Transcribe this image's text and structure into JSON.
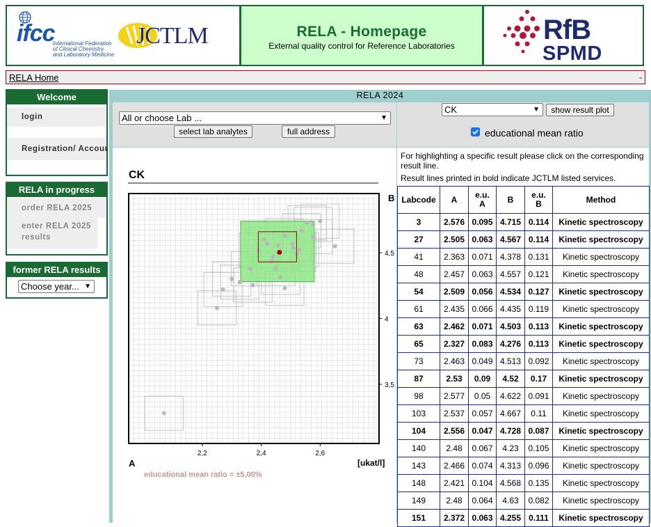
{
  "header": {
    "left_logo_1_text": "ifcc",
    "left_logo_1_sub": [
      "International Federation",
      "of Clinical Chemistry",
      "and Laboratory Medicine"
    ],
    "left_logo_2_text": "JCTLM",
    "title": "RELA - Homepage",
    "subtitle": "External quality control for Reference Laboratories",
    "right_logo_line1": "RfB",
    "right_logo_line2": "SPMD"
  },
  "navbar": {
    "home_link": "RELA Home",
    "right_text": "-"
  },
  "sidebar": {
    "welcome": {
      "title": "Welcome",
      "items": [
        "login",
        "Registration/ Account"
      ]
    },
    "progress": {
      "title": "RELA in progress",
      "items": [
        "order RELA 2025",
        "enter RELA 2025 results"
      ]
    },
    "former": {
      "title": "former RELA results",
      "select_value": "Choose year..."
    }
  },
  "main": {
    "title": "RELA 2024",
    "lab_select": "All or choose Lab ...",
    "select_analytes_button": "select lab analytes",
    "full_address_button": "full address",
    "analyte_select": "CK",
    "show_plot_button": "show result plot",
    "emr_checkbox_label": "educational mean ratio",
    "emr_checked": true,
    "info_line1": "For highlighting a specific result please click on the corresponding",
    "info_line2": "result line.",
    "info_line3": "Result lines printed in bold indicate JCTLM listed services."
  },
  "plot": {
    "title": "CK",
    "x_axis_label": "A",
    "y_axis_label": "B",
    "unit_label": "[ukat/l]",
    "emr_note": "educational mean ratio = ±5,00%",
    "x_ticks": [
      "2,2",
      "2,4",
      "2,6"
    ],
    "y_ticks": [
      "4,5",
      "4",
      "3,5"
    ]
  },
  "chart_data": {
    "type": "scatter",
    "x_axis": "A",
    "y_axis": "B",
    "xlim": [
      1.95,
      2.8
    ],
    "ylim": [
      3.05,
      4.95
    ],
    "grid": true,
    "points": [
      [
        2.576,
        4.715
      ],
      [
        2.505,
        4.567
      ],
      [
        2.363,
        4.378
      ],
      [
        2.457,
        4.557
      ],
      [
        2.509,
        4.534
      ],
      [
        2.435,
        4.435
      ],
      [
        2.462,
        4.503
      ],
      [
        2.327,
        4.276
      ],
      [
        2.463,
        4.513
      ],
      [
        2.53,
        4.52
      ],
      [
        2.577,
        4.622
      ],
      [
        2.537,
        4.667
      ],
      [
        2.556,
        4.728
      ],
      [
        2.48,
        4.23
      ],
      [
        2.466,
        4.313
      ],
      [
        2.421,
        4.568
      ],
      [
        2.48,
        4.63
      ],
      [
        2.372,
        4.255
      ],
      [
        2.6,
        4.74
      ],
      [
        2.65,
        4.55
      ],
      [
        2.3,
        4.3
      ],
      [
        2.27,
        4.22
      ],
      [
        2.25,
        4.08
      ],
      [
        2.44,
        4.47
      ],
      [
        2.41,
        4.6
      ],
      [
        2.39,
        4.52
      ],
      [
        2.45,
        4.38
      ],
      [
        2.52,
        4.49
      ],
      [
        2.07,
        3.28
      ]
    ],
    "highlight_point": [
      2.462,
      4.503
    ],
    "green_box": {
      "x": [
        2.33,
        2.58
      ],
      "y": [
        4.28,
        4.74
      ]
    },
    "red_box": {
      "x": [
        2.39,
        2.52
      ],
      "y": [
        4.43,
        4.66
      ]
    }
  },
  "table": {
    "headers": [
      "Labcode",
      "A",
      "e.u. A",
      "B",
      "e.u. B",
      "Method"
    ],
    "rows": [
      {
        "bold": true,
        "cells": [
          "3",
          "2.576",
          "0.095",
          "4.715",
          "0.114",
          "Kinetic spectroscopy"
        ]
      },
      {
        "bold": true,
        "cells": [
          "27",
          "2.505",
          "0.063",
          "4.567",
          "0.114",
          "Kinetic spectroscopy"
        ]
      },
      {
        "bold": false,
        "cells": [
          "41",
          "2.363",
          "0.071",
          "4.378",
          "0.131",
          "Kinetic spectroscopy"
        ]
      },
      {
        "bold": false,
        "cells": [
          "48",
          "2.457",
          "0.063",
          "4.557",
          "0.121",
          "Kinetic spectroscopy"
        ]
      },
      {
        "bold": true,
        "cells": [
          "54",
          "2.509",
          "0.056",
          "4.534",
          "0.127",
          "Kinetic spectroscopy"
        ]
      },
      {
        "bold": false,
        "cells": [
          "61",
          "2.435",
          "0.066",
          "4.435",
          "0.119",
          "Kinetic spectroscopy"
        ]
      },
      {
        "bold": true,
        "cells": [
          "63",
          "2.462",
          "0.071",
          "4.503",
          "0.113",
          "Kinetic spectroscopy"
        ]
      },
      {
        "bold": true,
        "cells": [
          "65",
          "2.327",
          "0.083",
          "4.276",
          "0.113",
          "Kinetic spectroscopy"
        ]
      },
      {
        "bold": false,
        "cells": [
          "73",
          "2.463",
          "0.049",
          "4.513",
          "0.092",
          "Kinetic spectroscopy"
        ]
      },
      {
        "bold": true,
        "cells": [
          "87",
          "2.53",
          "0.09",
          "4.52",
          "0.17",
          "Kinetic spectroscopy"
        ]
      },
      {
        "bold": false,
        "cells": [
          "98",
          "2.577",
          "0.05",
          "4.622",
          "0.091",
          "Kinetic spectroscopy"
        ]
      },
      {
        "bold": false,
        "cells": [
          "103",
          "2.537",
          "0.057",
          "4.667",
          "0.11",
          "Kinetic spectroscopy"
        ]
      },
      {
        "bold": true,
        "cells": [
          "104",
          "2.556",
          "0.047",
          "4.728",
          "0.087",
          "Kinetic spectroscopy"
        ]
      },
      {
        "bold": false,
        "cells": [
          "140",
          "2.48",
          "0.067",
          "4.23",
          "0.105",
          "Kinetic spectroscopy"
        ]
      },
      {
        "bold": false,
        "cells": [
          "143",
          "2.466",
          "0.074",
          "4.313",
          "0.096",
          "Kinetic spectroscopy"
        ]
      },
      {
        "bold": false,
        "cells": [
          "148",
          "2.421",
          "0.104",
          "4.568",
          "0.135",
          "Kinetic spectroscopy"
        ]
      },
      {
        "bold": false,
        "cells": [
          "149",
          "2.48",
          "0.064",
          "4.63",
          "0.082",
          "Kinetic spectroscopy"
        ]
      },
      {
        "bold": true,
        "cells": [
          "151",
          "2.372",
          "0.063",
          "4.255",
          "0.111",
          "Kinetic spectroscopy"
        ]
      }
    ]
  },
  "colors": {
    "brand_green": "#1a6b33",
    "title_bg": "#ccffcc",
    "main_bg": "#9ecfcf",
    "table_border": "#1a2a9a",
    "ifcc_blue": "#1d55a8",
    "rfb_red": "#b0173a",
    "rfb_navy": "#1f2b6b",
    "jctlm_yellow": "#f3d21b"
  }
}
